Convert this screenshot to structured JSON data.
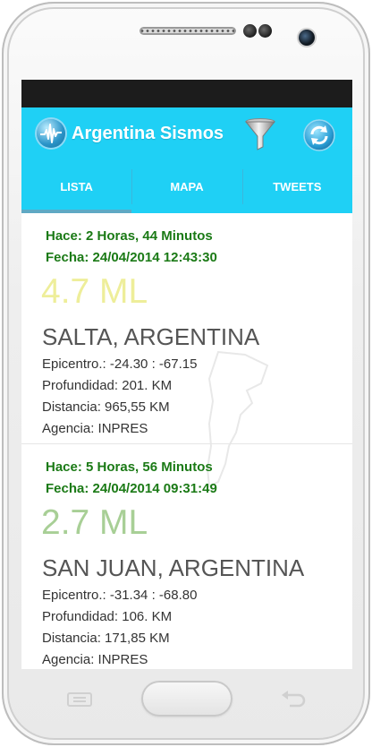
{
  "app": {
    "title": "Argentina Sismos"
  },
  "colors": {
    "actionbar": "#1fd0f5",
    "date_text": "#1b7a16",
    "status_bar": "#1c1c1c"
  },
  "icons": {
    "app": "seismograph-icon",
    "filter": "funnel-icon",
    "refresh": "refresh-icon"
  },
  "tabs": [
    {
      "label": "LISTA",
      "selected": true
    },
    {
      "label": "MAPA",
      "selected": false
    },
    {
      "label": "TWEETS",
      "selected": false
    }
  ],
  "quakes": [
    {
      "hace": "Hace: 2 Horas, 44 Minutos",
      "fecha": "Fecha: 24/04/2014 12:43:30",
      "magnitude": "4.7 ML",
      "magnitude_color": "#eeee9a",
      "place": "SALTA, ARGENTINA",
      "epicentro": "Epicentro.: -24.30 : -67.15",
      "profundidad": "Profundidad: 201. KM",
      "distancia": "Distancia: 965,55 KM",
      "agencia": "Agencia: INPRES"
    },
    {
      "hace": "Hace: 5 Horas, 56 Minutos",
      "fecha": "Fecha: 24/04/2014 09:31:49",
      "magnitude": "2.7 ML",
      "magnitude_color": "#a8cf96",
      "place": "SAN JUAN, ARGENTINA",
      "epicentro": "Epicentro.: -31.34 : -68.80",
      "profundidad": "Profundidad: 106. KM",
      "distancia": "Distancia: 171,85 KM",
      "agencia": "Agencia: INPRES"
    }
  ]
}
